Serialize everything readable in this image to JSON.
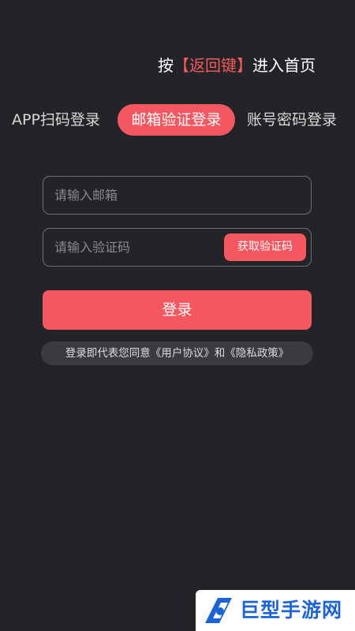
{
  "hint": {
    "prefix": "按",
    "key": "【返回键】",
    "suffix": "进入首页"
  },
  "tabs": {
    "app": "APP扫码登录",
    "email": "邮箱验证登录",
    "account": "账号密码登录",
    "active": "email"
  },
  "form": {
    "email_placeholder": "请输入邮箱",
    "email_value": "",
    "code_placeholder": "请输入验证码",
    "code_value": "",
    "get_code_label": "获取验证码",
    "login_label": "登录"
  },
  "agreement": {
    "text": "登录即代表您同意《用户协议》和《隐私政策》"
  },
  "watermark": {
    "text": "巨型手游网",
    "icon": "brand-logo-icon"
  },
  "colors": {
    "background": "#232427",
    "accent": "#f4575f",
    "watermark_blue": "#1a64d8"
  }
}
